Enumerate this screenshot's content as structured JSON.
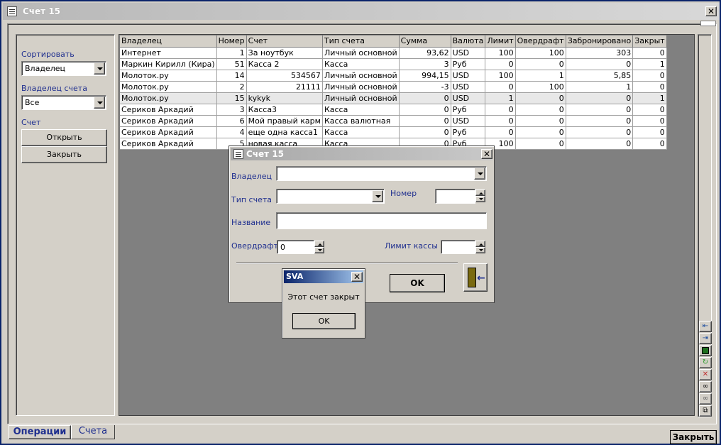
{
  "window": {
    "title": "Счет 15",
    "close_glyph": "✕"
  },
  "left_panel": {
    "sort_label": "Сортировать",
    "sort_value": "Владелец",
    "owner_label": "Владелец счета",
    "owner_value": "Все",
    "account_label": "Счет",
    "open_button": "Открыть",
    "close_button": "Закрыть"
  },
  "grid": {
    "columns": [
      "Владелец",
      "Номер",
      "Счет",
      "Тип счета",
      "Сумма",
      "Валюта",
      "Лимит",
      "Овердрафт",
      "Забронировано",
      "Закрыт"
    ],
    "rows": [
      [
        "Интернет",
        "1",
        "За ноутбук",
        "Личный основной",
        "93,62",
        "USD",
        "100",
        "100",
        "303",
        "0"
      ],
      [
        "Маркин Кирилл (Кира)",
        "51",
        "Касса 2",
        "Касса",
        "3",
        "Руб",
        "0",
        "0",
        "0",
        "1"
      ],
      [
        "Молоток.ру",
        "14",
        "534567",
        "Личный основной",
        "994,15",
        "USD",
        "100",
        "1",
        "5,85",
        "0"
      ],
      [
        "Молоток.ру",
        "2",
        "21111",
        "Личный основной",
        "-3",
        "USD",
        "0",
        "100",
        "1",
        "0"
      ],
      [
        "Молоток.ру",
        "15",
        "kykyk",
        "Личный основной",
        "0",
        "USD",
        "1",
        "0",
        "0",
        "1"
      ],
      [
        "Сериков Аркадий",
        "3",
        "Касса3",
        "Касса",
        "0",
        "Руб",
        "0",
        "0",
        "0",
        "0"
      ],
      [
        "Сериков Аркадий",
        "6",
        "Мой правый карм",
        "Касса валютная",
        "0",
        "USD",
        "0",
        "0",
        "0",
        "0"
      ],
      [
        "Сериков Аркадий",
        "4",
        "еще одна касса1",
        "Касса",
        "0",
        "Руб",
        "0",
        "0",
        "0",
        "0"
      ],
      [
        "Сериков Аркадий",
        "5",
        "новая касса",
        "Касса",
        "0",
        "Руб",
        "100",
        "0",
        "0",
        "0"
      ]
    ]
  },
  "tabs": {
    "operations": "Операции",
    "accounts": "Счета"
  },
  "bottom_close": "Закрыть",
  "dialog": {
    "title": "Счет 15",
    "owner_label": "Владелец",
    "type_label": "Тип счета",
    "number_label": "Номер",
    "name_label": "Название",
    "overdraft_label": "Овердрафт",
    "overdraft_value": "0",
    "limit_label": "Лимит кассы",
    "ok_button": "OK"
  },
  "msgbox": {
    "title": "SVA",
    "message": "Этот счет закрыт",
    "ok_button": "OK"
  },
  "icons": {
    "nav": [
      "nav-prev-icon",
      "nav-next-icon",
      "save-icon",
      "refresh-icon",
      "delete-icon",
      "find-icon",
      "find-next-icon",
      "copy-icon"
    ]
  }
}
